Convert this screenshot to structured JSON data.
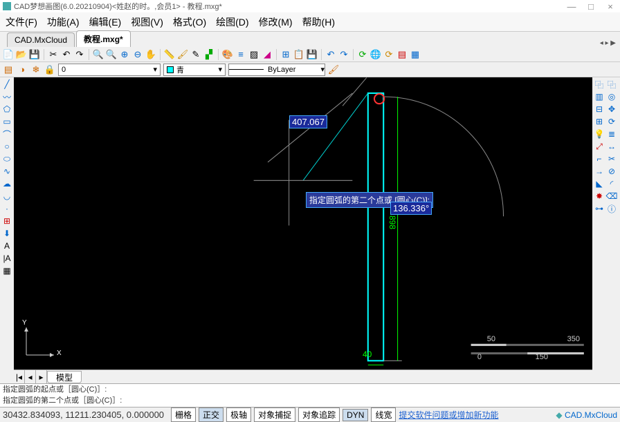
{
  "title": "CAD梦想画图(6.0.20210904)<姓赵的时。,会员1> - 教程.mxg*",
  "menu": {
    "file": "文件(F)",
    "func": "功能(A)",
    "edit": "编辑(E)",
    "view": "视图(V)",
    "format": "格式(O)",
    "draw": "绘图(D)",
    "modify": "修改(M)",
    "help": "帮助(H)"
  },
  "tabs": {
    "t1": "CAD.MxCloud",
    "t2": "教程.mxg*"
  },
  "layer": {
    "name": "0",
    "color": "青",
    "ltype": "ByLayer"
  },
  "canvas": {
    "dim_input": "407.067",
    "angle": "136.336°",
    "prompt": "指定圆弧的第二个点或 [圆心(C)]:",
    "dim_h": "898",
    "dim_w": "40",
    "scale1": "50",
    "scale2": "350",
    "scale3": "0",
    "scale4": "150",
    "ucs_x": "X",
    "ucs_y": "Y"
  },
  "model_tab": "模型",
  "cmd": {
    "l1": "指定圆弧的起点或［圆心(C)］:",
    "l2": "指定圆弧的第二个点或［圆心(C)］:"
  },
  "status": {
    "coords": "30432.834093, 11211.230405, 0.000000",
    "grid": "栅格",
    "ortho": "正交",
    "polar": "极轴",
    "osnap": "对象捕捉",
    "otrack": "对象追踪",
    "dyn": "DYN",
    "lwt": "线宽",
    "link": "提交软件问题或增加新功能",
    "brand": "CAD.MxCloud"
  }
}
